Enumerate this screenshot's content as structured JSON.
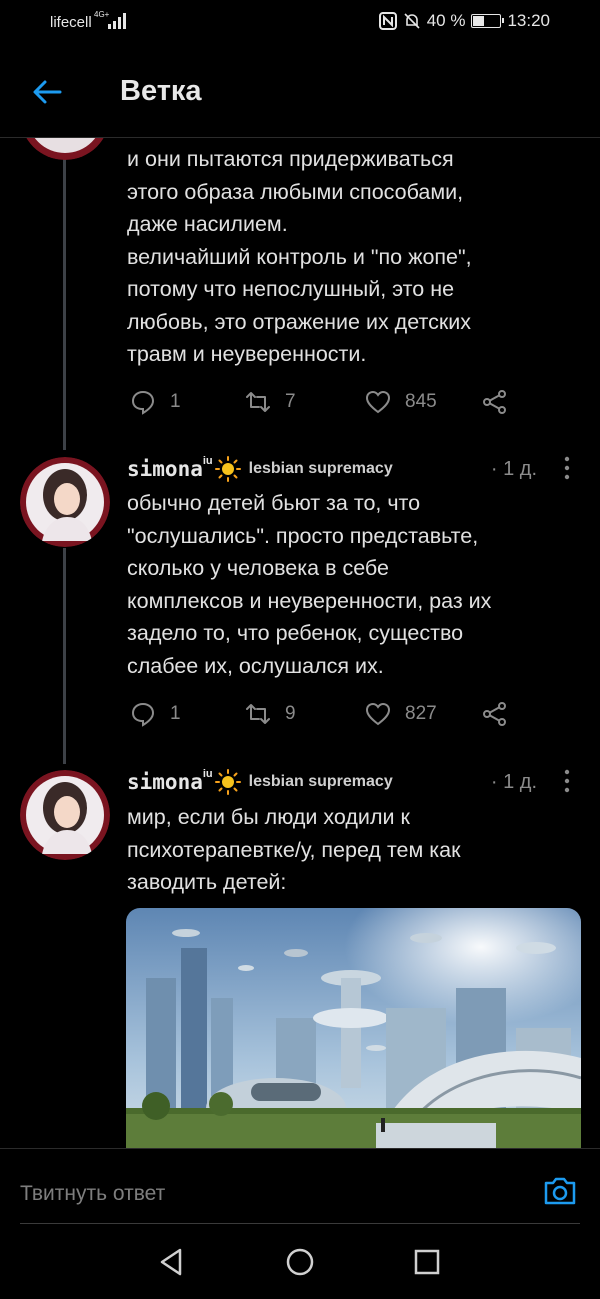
{
  "status_bar": {
    "carrier": "lifecell",
    "network": "4G+",
    "battery": "40 %",
    "time": "13:20"
  },
  "header": {
    "title": "Ветка"
  },
  "tweets": [
    {
      "text": "и они пытаются придерживаться\nэтого образа любыми способами,\nдаже насилием.\nвеличайший контроль и \"по жопе\",\nпотому что непослушный, это не\nлюбовь, это отражение их детских\nтравм и неуверенности.",
      "replies": "1",
      "retweets": "7",
      "likes": "845"
    },
    {
      "name": "simona",
      "name_sup": "iu",
      "handle": "lesbian supremacy",
      "time": "· 1 д.",
      "text": "обычно детей бьют за то, что\n\"ослушались\". просто представьте,\nсколько у человека в себе\nкомплексов и неуверенности, раз их\nзадело то, что ребенок, существо\nслабее их, ослушался их.",
      "replies": "1",
      "retweets": "9",
      "likes": "827"
    },
    {
      "name": "simona",
      "name_sup": "iu",
      "handle": "lesbian supremacy",
      "time": "· 1 д.",
      "text": "мир, если бы люди ходили к\nпсихотерапевтке/у, перед тем как\nзаводить детей:",
      "image": "futuristic-city-image"
    }
  ],
  "reply_bar": {
    "placeholder": "Твитнуть ответ"
  },
  "colors": {
    "background": "#000000",
    "accent": "#1d9bf0",
    "muted": "#8b8b8b"
  }
}
